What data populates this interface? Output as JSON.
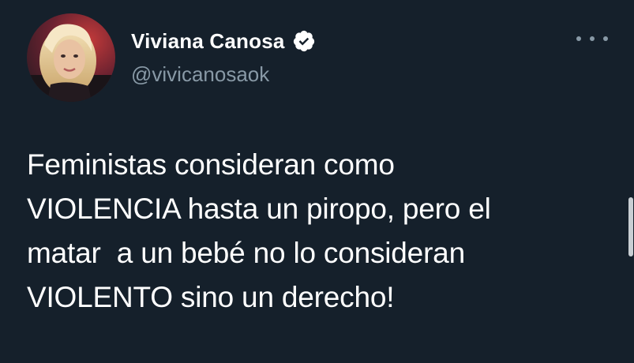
{
  "author": {
    "display_name": "Viviana Canosa",
    "handle": "@vivicanosaok",
    "verified": true,
    "avatar_icon": "profile-photo"
  },
  "menu": {
    "icon": "more-horizontal-icon"
  },
  "tweet": {
    "lines": [
      "Feministas consideran como",
      "VIOLENCIA hasta un piropo, pero el",
      "matar  a un bebé no lo consideran",
      "VIOLENTO sino un derecho!"
    ]
  },
  "colors": {
    "background": "#15202b",
    "text_primary": "#ffffff",
    "text_secondary": "#8899a6",
    "verified_badge": "#ffffff"
  }
}
